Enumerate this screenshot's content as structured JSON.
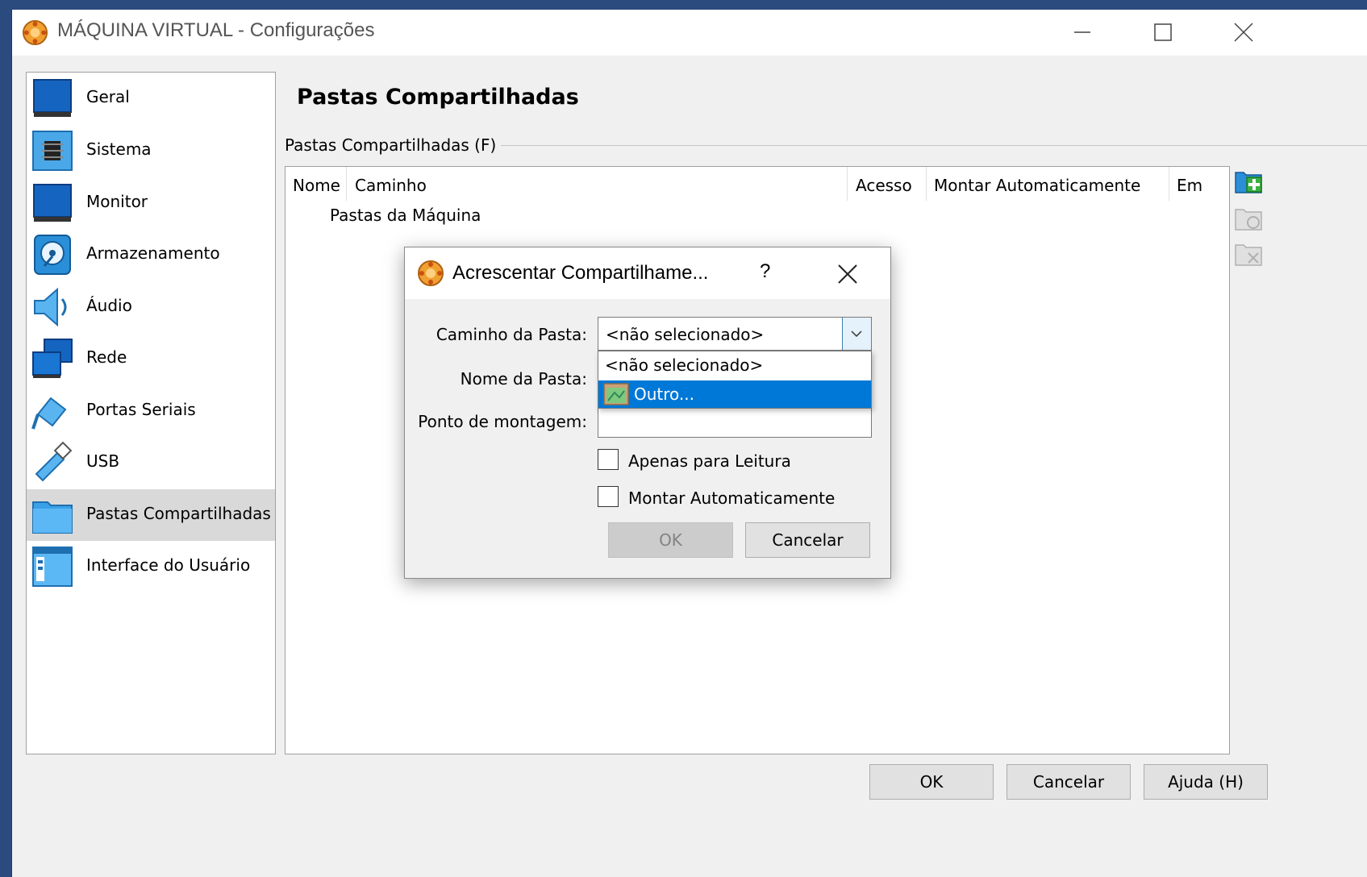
{
  "window": {
    "title": "MÁQUINA VIRTUAL - Configurações"
  },
  "sidebar": {
    "items": [
      {
        "label": "Geral",
        "icon": "monitor-icon"
      },
      {
        "label": "Sistema",
        "icon": "chip-icon"
      },
      {
        "label": "Monitor",
        "icon": "display-icon"
      },
      {
        "label": "Armazenamento",
        "icon": "disk-icon"
      },
      {
        "label": "Áudio",
        "icon": "speaker-icon"
      },
      {
        "label": "Rede",
        "icon": "network-icon"
      },
      {
        "label": "Portas Seriais",
        "icon": "serial-port-icon"
      },
      {
        "label": "USB",
        "icon": "usb-icon"
      },
      {
        "label": "Pastas Compartilhadas",
        "icon": "folder-icon",
        "selected": true
      },
      {
        "label": "Interface do Usuário",
        "icon": "user-interface-icon"
      }
    ]
  },
  "main": {
    "title": "Pastas Compartilhadas",
    "group_label": "Pastas Compartilhadas (F)",
    "columns": [
      "Nome",
      "Caminho",
      "Acesso",
      "Montar Automaticamente",
      "Em"
    ],
    "machine_row": "Pastas da Máquina"
  },
  "buttons": {
    "ok": "OK",
    "cancel": "Cancelar",
    "help": "Ajuda (H)"
  },
  "dialog": {
    "title": "Acrescentar Compartilhame...",
    "help_glyph": "?",
    "labels": {
      "path": "Caminho da Pasta:",
      "name": "Nome da Pasta:",
      "mount": "Ponto de montagem:"
    },
    "path_value": "<não selecionado>",
    "dropdown_options": [
      "<não selecionado>",
      "Outro..."
    ],
    "highlighted_option": "Outro...",
    "checkboxes": {
      "read_only": "Apenas para Leitura",
      "auto_mount": "Montar Automaticamente"
    },
    "ok_label": "OK",
    "cancel_label": "Cancelar"
  },
  "colors": {
    "selection": "#0078d7",
    "desktop": "#2b4a7e",
    "sidebar_selected": "#d9d9d9"
  }
}
